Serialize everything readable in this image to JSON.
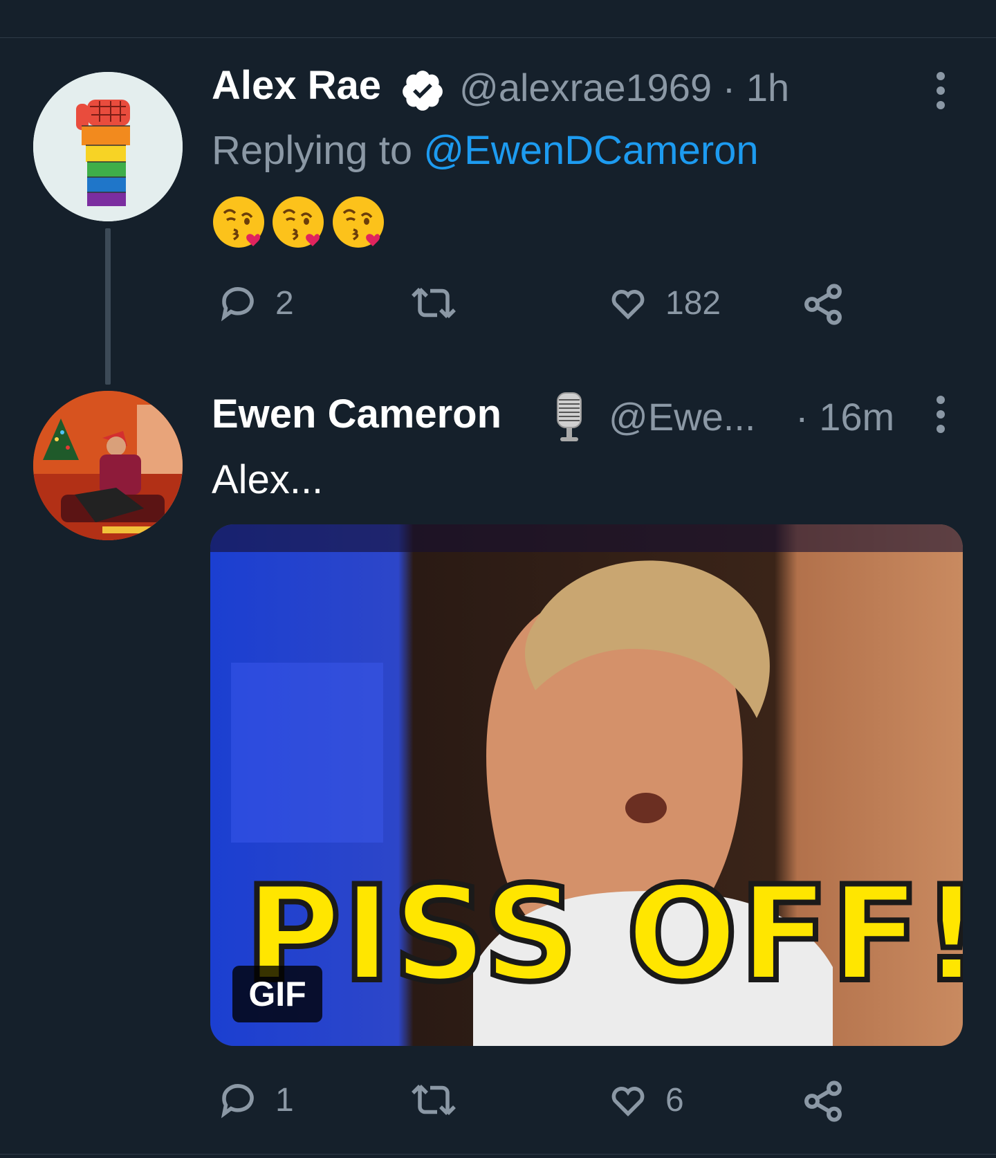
{
  "tweets": [
    {
      "name": "Alex Rae",
      "handle": "@alexrae1969 · 1h",
      "replying_prefix": "Replying to ",
      "replying_to": "@EwenDCameron",
      "emoji": [
        "kissing-face-emoji",
        "kissing-face-emoji",
        "kissing-face-emoji"
      ],
      "replies": "2",
      "likes": "182",
      "verified": true
    },
    {
      "name": "Ewen Cameron",
      "handle": "@Ewe...",
      "time": "· 16m",
      "text": "Alex...",
      "media": {
        "caption_text": "PISS OFF!",
        "badge": "GIF"
      },
      "replies": "1",
      "likes": "6"
    }
  ],
  "colors": {
    "background": "#15202b",
    "secondary_text": "#8b98a5",
    "link": "#1d9bf0",
    "divider": "#2f3b47"
  }
}
